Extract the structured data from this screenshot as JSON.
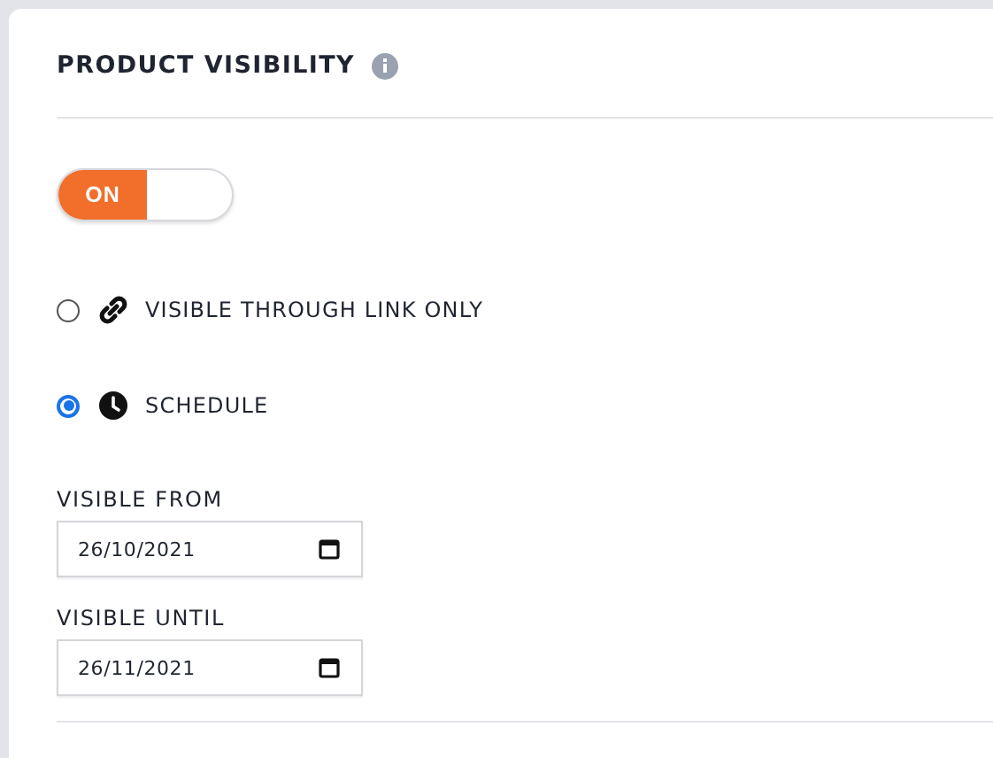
{
  "panel": {
    "title": "PRODUCT VISIBILITY"
  },
  "toggle": {
    "on": true,
    "label": "ON"
  },
  "options": [
    {
      "kind": "link",
      "label": "VISIBLE THROUGH LINK ONLY",
      "selected": false
    },
    {
      "kind": "clock",
      "label": "SCHEDULE",
      "selected": true
    }
  ],
  "dates": [
    {
      "label": "VISIBLE FROM",
      "value": "26/10/2021"
    },
    {
      "label": "VISIBLE UNTIL",
      "value": "26/11/2021"
    }
  ]
}
